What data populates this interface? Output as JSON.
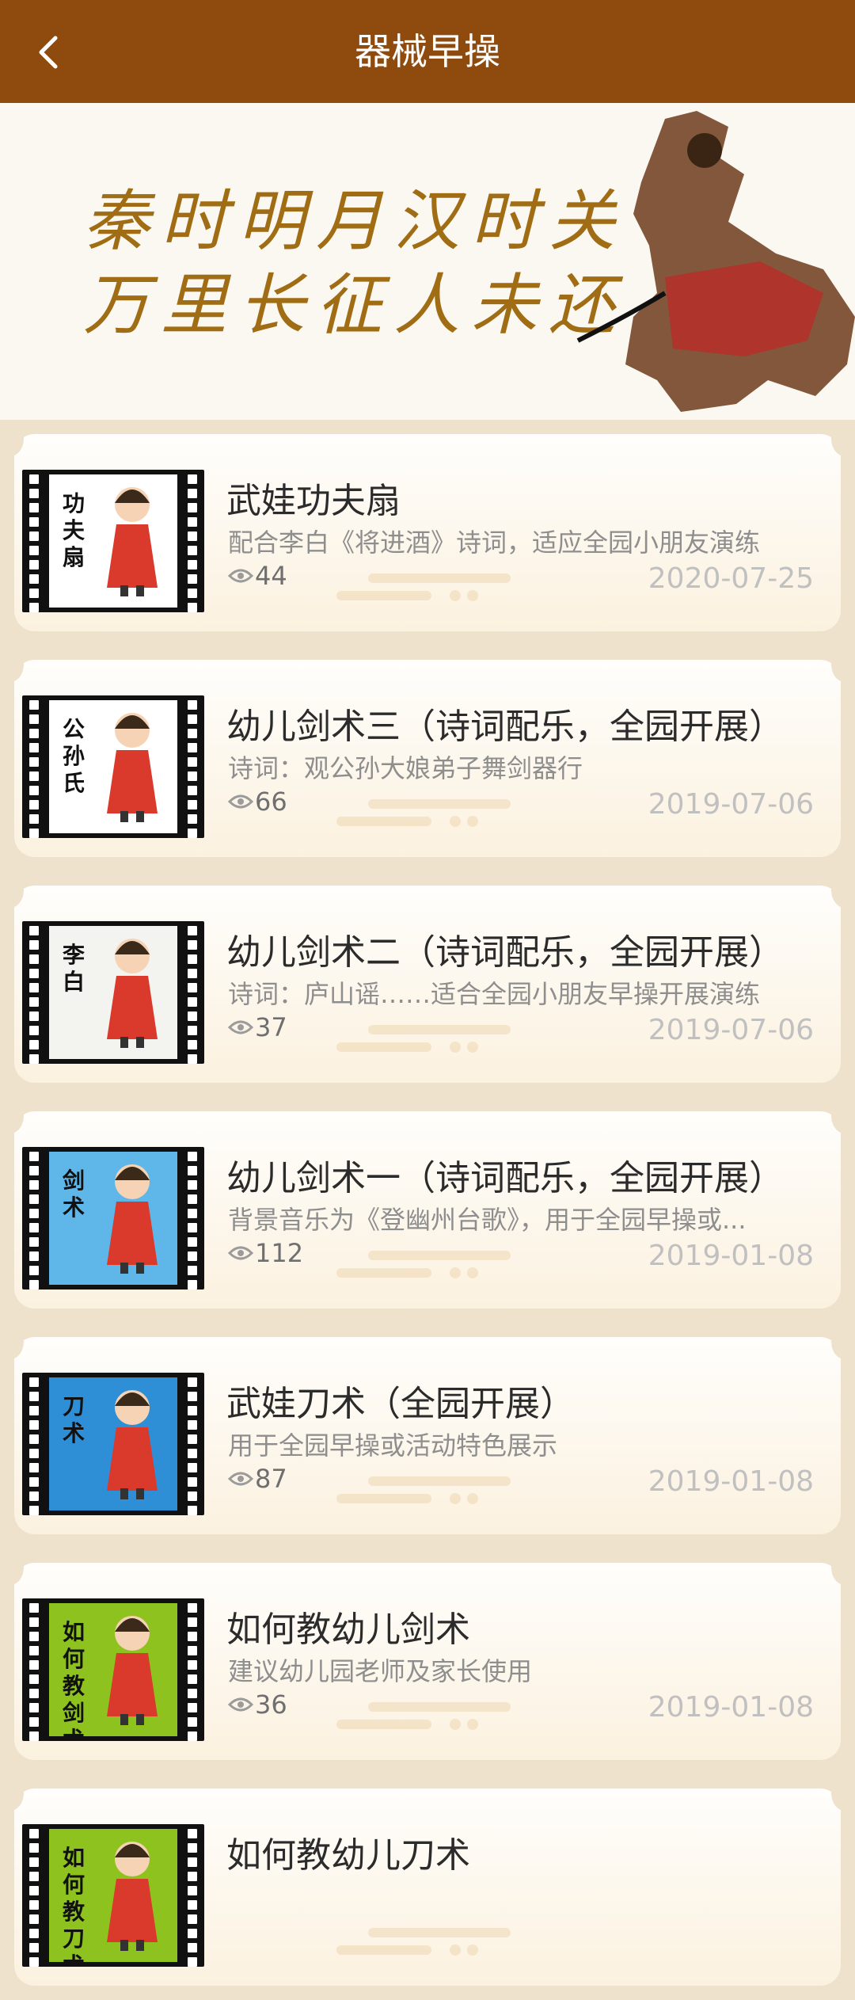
{
  "header": {
    "title": "器械早操",
    "back_icon": "chevron-left-icon"
  },
  "banner": {
    "line1": "秦时明月汉时关",
    "line2": "万里长征人未还"
  },
  "items": [
    {
      "title": "武娃功夫扇",
      "desc": "配合李白《将进酒》诗词，适应全园小朋友演练",
      "views": "44",
      "date": "2020-07-25",
      "thumb_text": "功夫扇",
      "thumb_bg": "#ffffff"
    },
    {
      "title": "幼儿剑术三（诗词配乐，全园开展）",
      "desc": "诗词：观公孙大娘弟子舞剑器行",
      "views": "66",
      "date": "2019-07-06",
      "thumb_text": "公孙氏",
      "thumb_bg": "#ffffff"
    },
    {
      "title": "幼儿剑术二（诗词配乐，全园开展）",
      "desc": "诗词：庐山谣……适合全园小朋友早操开展演练",
      "views": "37",
      "date": "2019-07-06",
      "thumb_text": "李白",
      "thumb_bg": "#f3f4ef"
    },
    {
      "title": "幼儿剑术一（诗词配乐，全园开展）",
      "desc": "背景音乐为《登幽州台歌》，用于全园早操或...",
      "views": "112",
      "date": "2019-01-08",
      "thumb_text": "剑术",
      "thumb_bg": "#5fb6e8"
    },
    {
      "title": "武娃刀术（全园开展）",
      "desc": "用于全园早操或活动特色展示",
      "views": "87",
      "date": "2019-01-08",
      "thumb_text": "刀术",
      "thumb_bg": "#2f8fd6"
    },
    {
      "title": "如何教幼儿剑术",
      "desc": "建议幼儿园老师及家长使用",
      "views": "36",
      "date": "2019-01-08",
      "thumb_text": "如何教剑术",
      "thumb_bg": "#8dc21f"
    },
    {
      "title": "如何教幼儿刀术",
      "desc": "",
      "views": "",
      "date": "",
      "thumb_text": "如何教刀术",
      "thumb_bg": "#8dc21f"
    }
  ]
}
